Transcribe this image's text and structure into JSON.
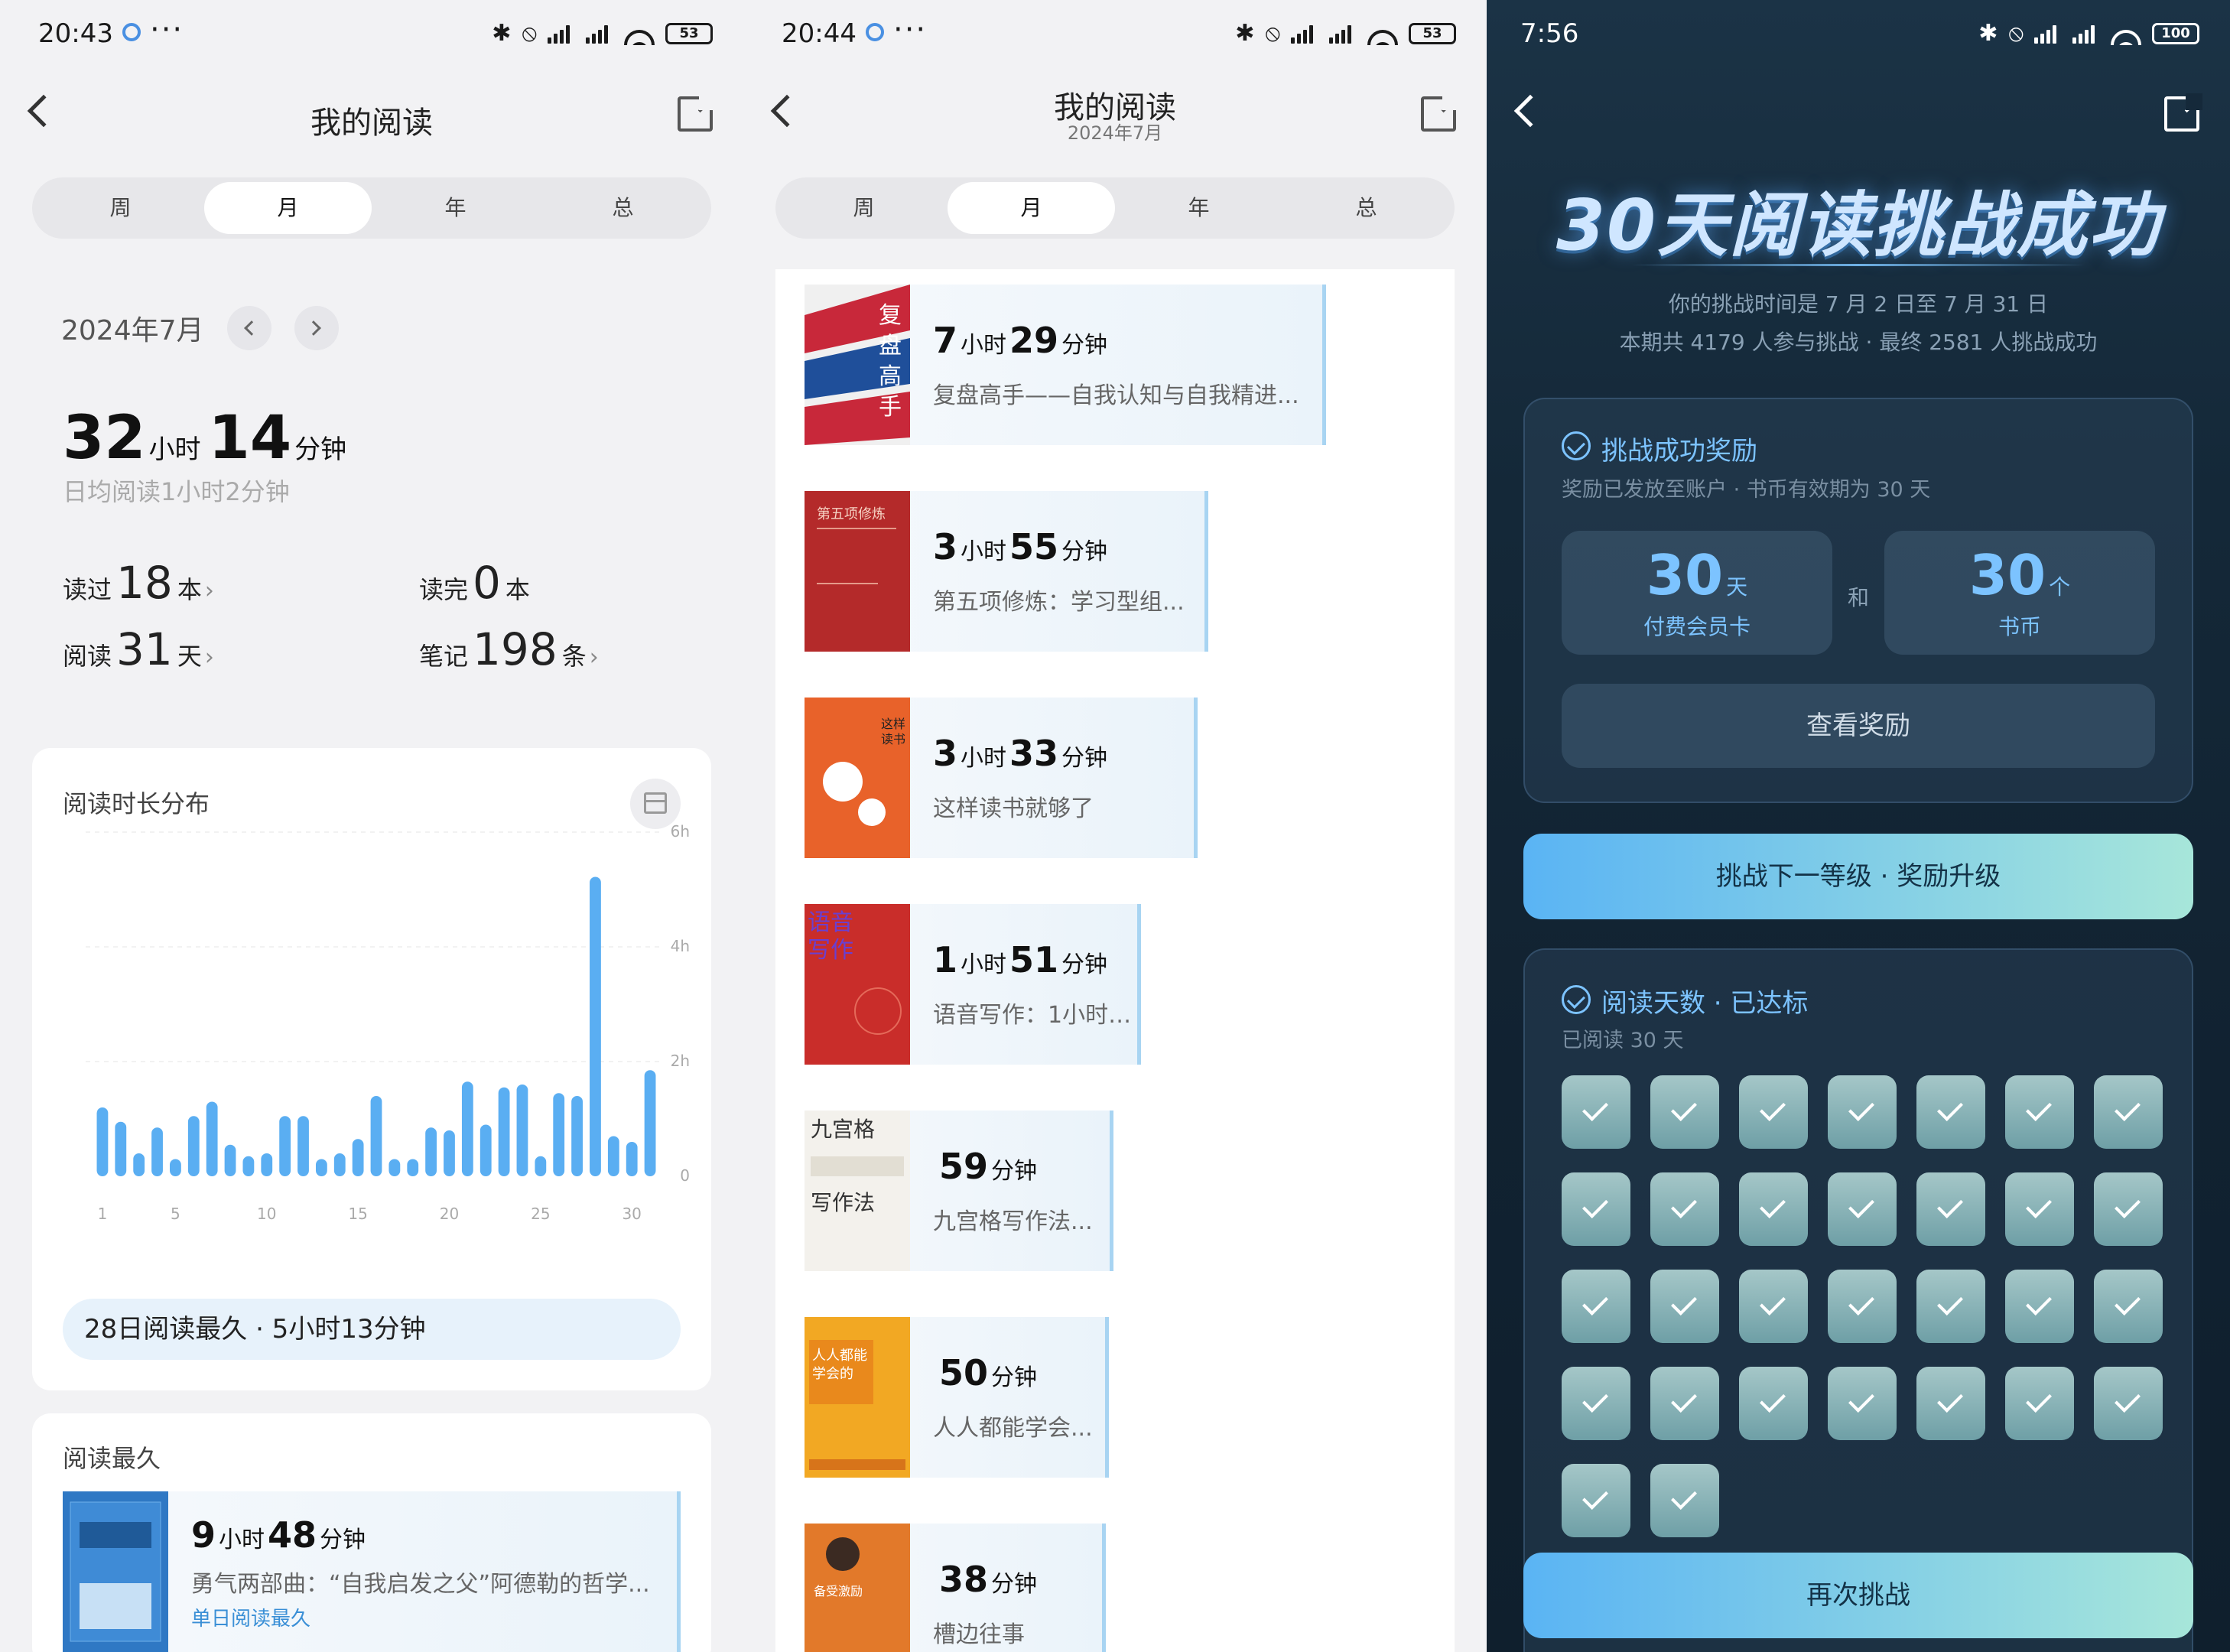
{
  "panel1": {
    "status": {
      "time": "20:43",
      "dots": "···",
      "battery": "53"
    },
    "nav": {
      "title": "我的阅读"
    },
    "tabs": [
      "周",
      "月",
      "年",
      "总"
    ],
    "active_tab": "月",
    "month": "2024年7月",
    "total": {
      "hours": "32",
      "hours_unit": "小时",
      "minutes": "14",
      "minutes_unit": "分钟"
    },
    "daily_avg": "日均阅读1小时2分钟",
    "stats": {
      "read_label": "读过",
      "read_value": "18",
      "read_unit": "本",
      "finished_label": "读完",
      "finished_value": "0",
      "finished_unit": "本",
      "days_label": "阅读",
      "days_value": "31",
      "days_unit": "天",
      "notes_label": "笔记",
      "notes_value": "198",
      "notes_unit": "条"
    },
    "distribution_title": "阅读时长分布",
    "best_day": "28日阅读最久 · 5小时13分钟",
    "longest": {
      "section_title": "阅读最久",
      "time_h": "9",
      "time_h_unit": "小时",
      "time_m": "48",
      "time_m_unit": "分钟",
      "book": "勇气两部曲：“自我启发之父”阿德勒的哲学...",
      "tag": "单日阅读最久"
    }
  },
  "chart_data": {
    "type": "bar",
    "title": "阅读时长分布",
    "x": [
      1,
      2,
      3,
      4,
      5,
      6,
      7,
      8,
      9,
      10,
      11,
      12,
      13,
      14,
      15,
      16,
      17,
      18,
      19,
      20,
      21,
      22,
      23,
      24,
      25,
      26,
      27,
      28,
      29,
      30,
      31
    ],
    "values": [
      1.2,
      0.95,
      0.4,
      0.85,
      0.3,
      1.05,
      1.3,
      0.55,
      0.35,
      0.4,
      1.05,
      1.05,
      0.3,
      0.4,
      0.65,
      1.4,
      0.3,
      0.3,
      0.85,
      0.8,
      1.65,
      0.9,
      1.55,
      1.6,
      0.35,
      1.45,
      1.4,
      5.22,
      0.7,
      0.6,
      1.85
    ],
    "xticks": [
      "1",
      "5",
      "10",
      "15",
      "20",
      "25",
      "30"
    ],
    "xtick_values": [
      1,
      5,
      10,
      15,
      20,
      25,
      30
    ],
    "yticks": [
      "0",
      "2h",
      "4h",
      "6h"
    ],
    "ytick_values": [
      0,
      2,
      4,
      6
    ],
    "ylim": [
      0,
      6
    ],
    "grid": true,
    "bar_color": "#5aaef2"
  },
  "panel2": {
    "status": {
      "time": "20:44",
      "dots": "···",
      "battery": "53"
    },
    "nav": {
      "title": "我的阅读",
      "subtitle": "2024年7月"
    },
    "tabs": [
      "周",
      "月",
      "年",
      "总"
    ],
    "active_tab": "月",
    "books": [
      {
        "h": "7",
        "hu": "小时",
        "m": "29",
        "mu": "分钟",
        "title": "复盘高手——自我认知与自我精进...",
        "cover_text": "复盘高手",
        "cover_color": "#c8283a"
      },
      {
        "h": "3",
        "hu": "小时",
        "m": "55",
        "mu": "分钟",
        "title": "第五项修炼：学习型组...",
        "cover_text": "第五项修炼",
        "cover_color": "#b42a2a"
      },
      {
        "h": "3",
        "hu": "小时",
        "m": "33",
        "mu": "分钟",
        "title": "这样读书就够了",
        "cover_text": "这样读书就够了",
        "cover_color": "#e8622a"
      },
      {
        "h": "1",
        "hu": "小时",
        "m": "51",
        "mu": "分钟",
        "title": "语音写作：1小时1...",
        "cover_text": "语音写作",
        "cover_color": "#c92d2a"
      },
      {
        "h": "",
        "hu": "",
        "m": "59",
        "mu": "分钟",
        "title": "九宫格写作法...",
        "cover_text": "九宫格写作法",
        "cover_color": "#f3f1ec"
      },
      {
        "h": "",
        "hu": "",
        "m": "50",
        "mu": "分钟",
        "title": "人人都能学会...",
        "cover_text": "人人都能学会的写作变现指南",
        "cover_color": "#f2a823"
      },
      {
        "h": "",
        "hu": "",
        "m": "38",
        "mu": "分钟",
        "title": "槽边往事",
        "cover_text": "备受激励",
        "cover_color": "#e2792a"
      }
    ]
  },
  "panel3": {
    "status": {
      "time": "7:56",
      "battery": "100"
    },
    "hero": "30天阅读挑战成功",
    "period": "你的挑战时间是 7 月 2 日至 7 月 31 日",
    "participants": "本期共 4179 人参与挑战 · 最终 2581 人挑战成功",
    "reward": {
      "title": "挑战成功奖励",
      "subtitle": "奖励已发放至账户 · 书币有效期为 30 天",
      "card_value": "30",
      "card_unit": "天",
      "card_label": "付费会员卡",
      "and": "和",
      "coin_value": "30",
      "coin_unit": "个",
      "coin_label": "书币",
      "view_button": "查看奖励"
    },
    "next_button": "挑战下一等级 · 奖励升级",
    "days": {
      "title": "阅读天数 · 已达标",
      "subtitle": "已阅读 30 天",
      "count": 30
    },
    "retry_button": "再次挑战",
    "accent": "#7cc3ff"
  }
}
